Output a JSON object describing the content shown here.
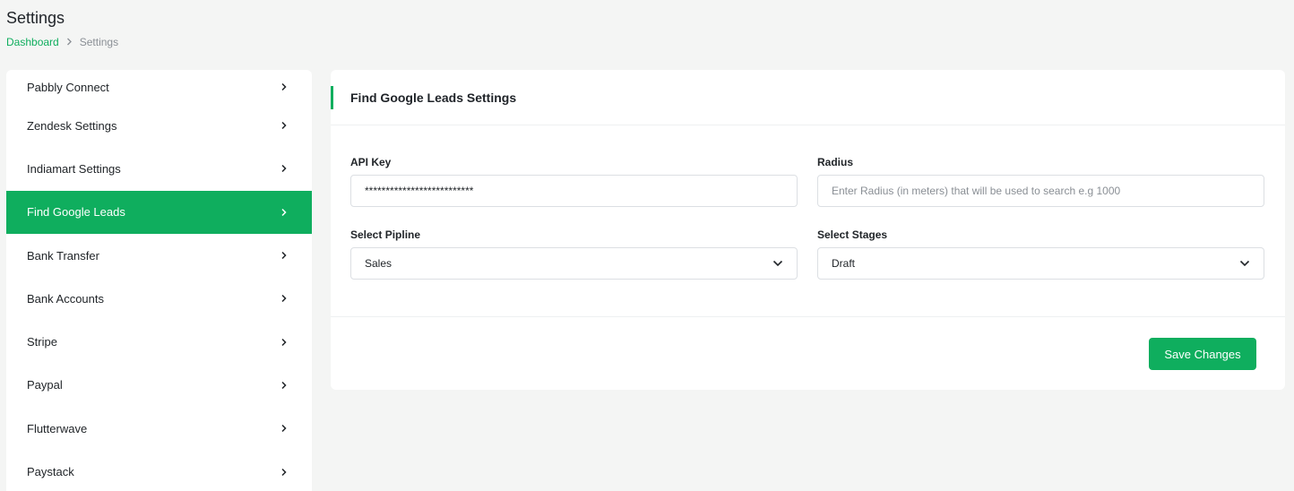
{
  "page": {
    "title": "Settings",
    "breadcrumb": {
      "home": "Dashboard",
      "current": "Settings"
    }
  },
  "sidebar": {
    "items": [
      {
        "label": "Pabbly Connect"
      },
      {
        "label": "Zendesk Settings"
      },
      {
        "label": "Indiamart Settings"
      },
      {
        "label": "Find Google Leads",
        "active": true
      },
      {
        "label": "Bank Transfer"
      },
      {
        "label": "Bank Accounts"
      },
      {
        "label": "Stripe"
      },
      {
        "label": "Paypal"
      },
      {
        "label": "Flutterwave"
      },
      {
        "label": "Paystack"
      }
    ]
  },
  "card": {
    "title": "Find Google Leads Settings",
    "fields": {
      "api_key": {
        "label": "API Key",
        "value": "**************************"
      },
      "radius": {
        "label": "Radius",
        "placeholder": "Enter Radius (in meters) that will be used to search e.g 1000"
      },
      "pipeline": {
        "label": "Select Pipline",
        "value": "Sales"
      },
      "stages": {
        "label": "Select Stages",
        "value": "Draft"
      }
    },
    "save_label": "Save Changes"
  },
  "colors": {
    "accent": "#0fae5e",
    "background": "#f4f5f4"
  }
}
